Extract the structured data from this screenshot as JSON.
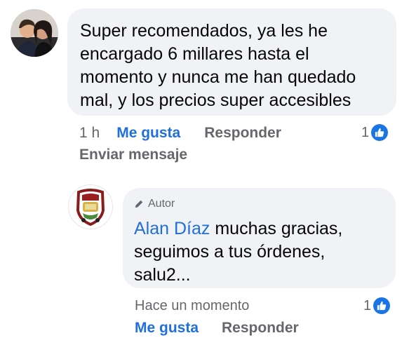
{
  "comments": [
    {
      "text": "Super recomendados, ya les he encargado 6 millares hasta el momento y nunca me han quedado mal, y los precios super accesibles",
      "time": "1 h",
      "like_label": "Me gusta",
      "reply_label": "Responder",
      "reaction_count": "1",
      "send_message_label": "Enviar mensaje"
    }
  ],
  "reply": {
    "author_badge": "Autor",
    "author_name": "Alan Díaz",
    "text": "muchas gracias, seguimos a tus órdenes, salu2...",
    "time": "Hace un momento",
    "like_label": "Me gusta",
    "reply_label": "Responder",
    "reaction_count": "1"
  },
  "colors": {
    "link": "#216fdb",
    "like_badge": "#1b74e4",
    "bubble": "#f0f2f5",
    "meta_text": "#65676b"
  },
  "icons": [
    "like-reaction-icon",
    "pencil-icon"
  ]
}
